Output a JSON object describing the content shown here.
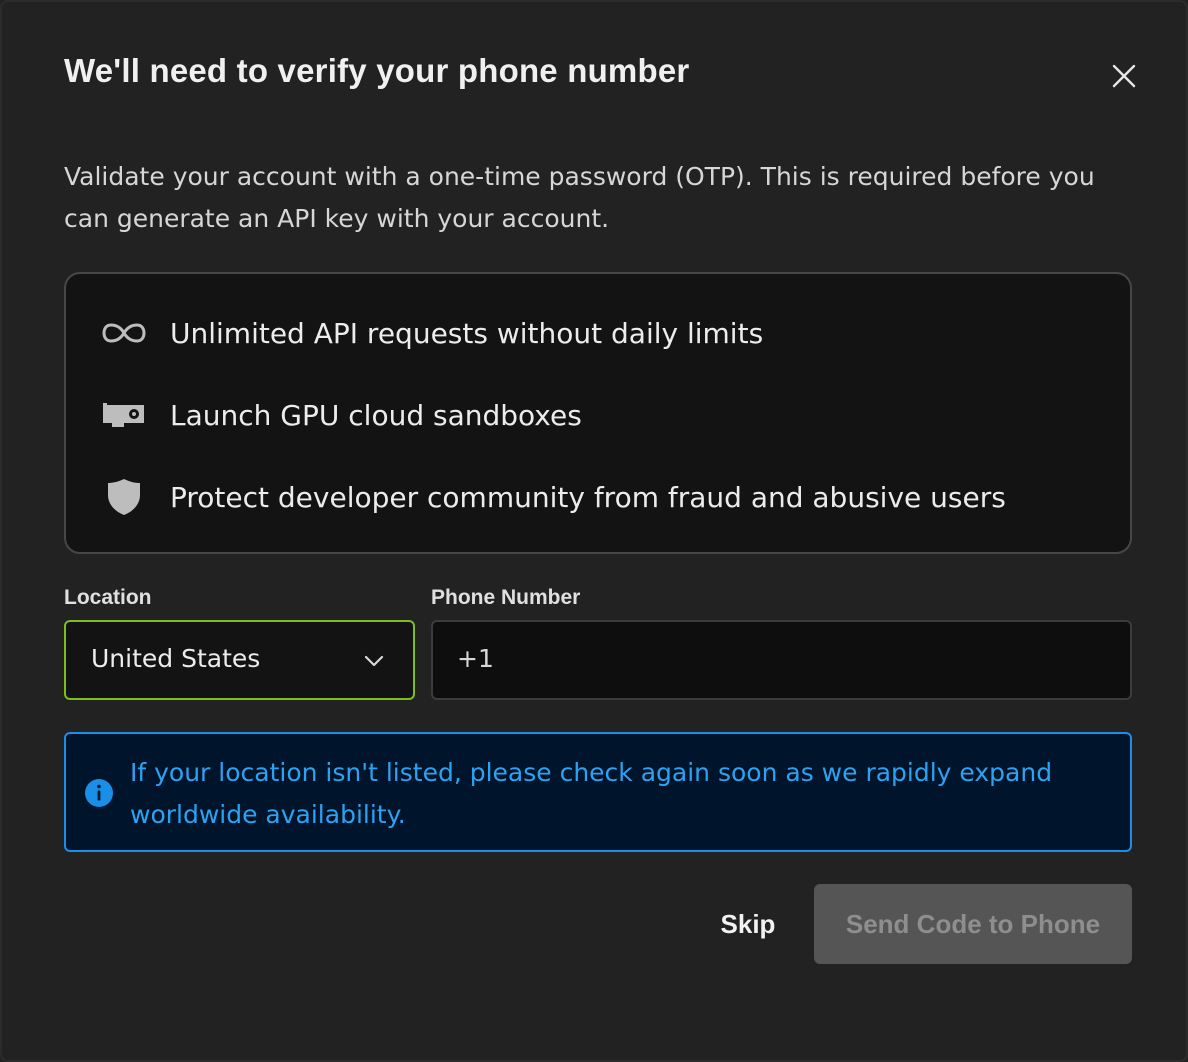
{
  "dialog": {
    "title": "We'll need to verify your phone number",
    "close_icon": "close-icon",
    "description": "Validate your account with a one-time password (OTP). This is required before you can generate an API key with your account."
  },
  "benefits": [
    {
      "icon": "infinity-icon",
      "label": "Unlimited API requests without daily limits"
    },
    {
      "icon": "gpu-card-icon",
      "label": "Launch GPU cloud sandboxes"
    },
    {
      "icon": "shield-icon",
      "label": "Protect developer community from fraud and abusive users"
    }
  ],
  "form": {
    "location_label": "Location",
    "location_value": "United States",
    "phone_label": "Phone Number",
    "phone_prefix": "+1",
    "phone_value": ""
  },
  "info": {
    "icon": "info-icon",
    "text": "If your location isn't listed, please check again soon as we rapidly expand worldwide availability."
  },
  "actions": {
    "skip_label": "Skip",
    "send_label": "Send Code to Phone"
  },
  "colors": {
    "background": "#222222",
    "select_border_focus": "#7bbf1f",
    "info_border": "#1a8fe8",
    "info_text": "#2ba3f2",
    "disabled_button": "#555555"
  }
}
